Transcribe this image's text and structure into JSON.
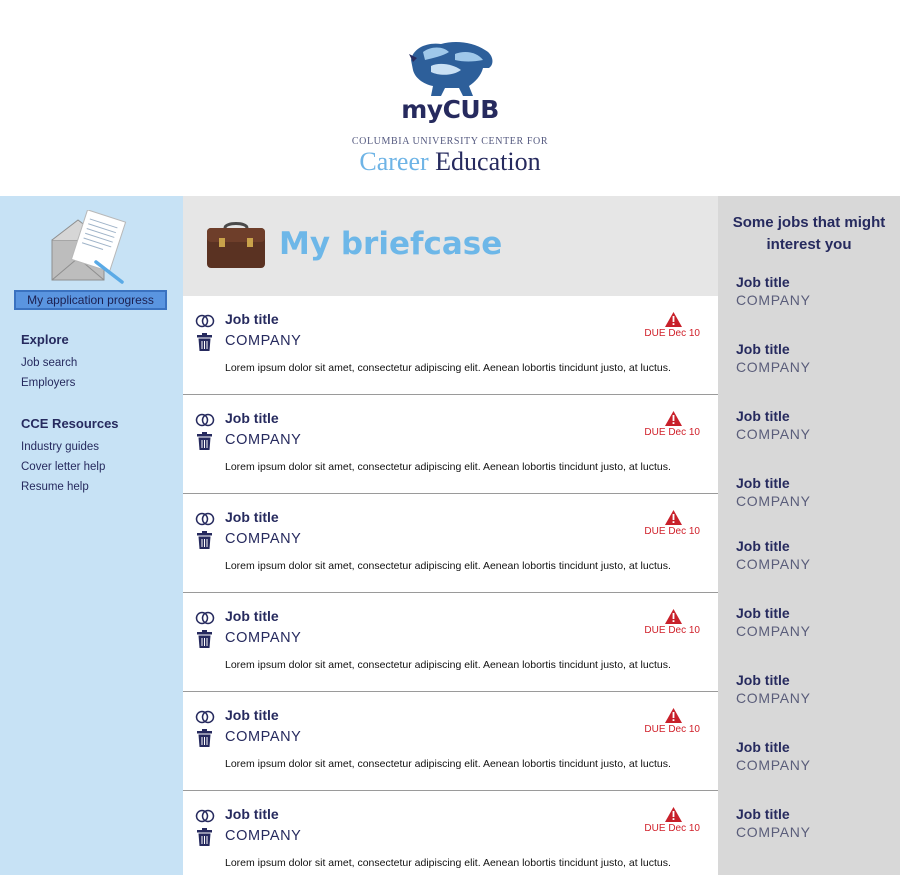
{
  "header": {
    "logo_word": "myCUB",
    "logo_sub": "COLUMBIA UNIVERSITY CENTER FOR",
    "logo_career_1": "Career",
    "logo_career_2": "Education"
  },
  "sidebar": {
    "progress_button": "My application progress",
    "explore": {
      "heading": "Explore",
      "links": [
        "Job search",
        "Employers"
      ]
    },
    "resources": {
      "heading": "CCE Resources",
      "links": [
        "Industry guides",
        "Cover letter help",
        "Resume help"
      ]
    }
  },
  "main": {
    "title": "My briefcase",
    "cards": [
      {
        "job": "Job title",
        "company": "COMPANY",
        "due": "DUE Dec 10",
        "desc": "Lorem ipsum dolor sit amet, consectetur adipiscing elit. Aenean lobortis tincidunt justo, at luctus."
      },
      {
        "job": "Job title",
        "company": "COMPANY",
        "due": "DUE Dec 10",
        "desc": "Lorem ipsum dolor sit amet, consectetur adipiscing elit. Aenean lobortis tincidunt justo, at luctus."
      },
      {
        "job": "Job title",
        "company": "COMPANY",
        "due": "DUE Dec 10",
        "desc": "Lorem ipsum dolor sit amet, consectetur adipiscing elit. Aenean lobortis tincidunt justo, at luctus."
      },
      {
        "job": "Job title",
        "company": "COMPANY",
        "due": "DUE Dec 10",
        "desc": "Lorem ipsum dolor sit amet, consectetur adipiscing elit. Aenean lobortis tincidunt justo, at luctus."
      },
      {
        "job": "Job title",
        "company": "COMPANY",
        "due": "DUE Dec 10",
        "desc": "Lorem ipsum dolor sit amet, consectetur adipiscing elit. Aenean lobortis tincidunt justo, at luctus."
      },
      {
        "job": "Job title",
        "company": "COMPANY",
        "due": "DUE Dec 10",
        "desc": "Lorem ipsum dolor sit amet, consectetur adipiscing elit. Aenean lobortis tincidunt justo, at luctus."
      }
    ]
  },
  "right": {
    "title": "Some jobs that might interest you",
    "items": [
      {
        "job": "Job title",
        "company": "COMPANY"
      },
      {
        "job": "Job title",
        "company": "COMPANY"
      },
      {
        "job": "Job title",
        "company": "COMPANY"
      },
      {
        "job": "Job title",
        "company": "COMPANY"
      },
      {
        "job": "Job title",
        "company": "COMPANY"
      },
      {
        "job": "Job title",
        "company": "COMPANY"
      },
      {
        "job": "Job title",
        "company": "COMPANY"
      },
      {
        "job": "Job title",
        "company": "COMPANY"
      },
      {
        "job": "Job title",
        "company": "COMPANY"
      }
    ]
  },
  "colors": {
    "navy": "#262a5e",
    "light_blue": "#6db7e8",
    "sidebar_bg": "#c7e2f5",
    "right_bg": "#d8d8d8",
    "due_red": "#d0202a"
  },
  "icons": {
    "logo": "lion-icon",
    "sidebar_image": "envelope-letter-icon",
    "header_image": "briefcase-icon",
    "card_action_1": "rings-icon",
    "card_action_2": "trash-icon",
    "card_status": "warning-icon"
  }
}
